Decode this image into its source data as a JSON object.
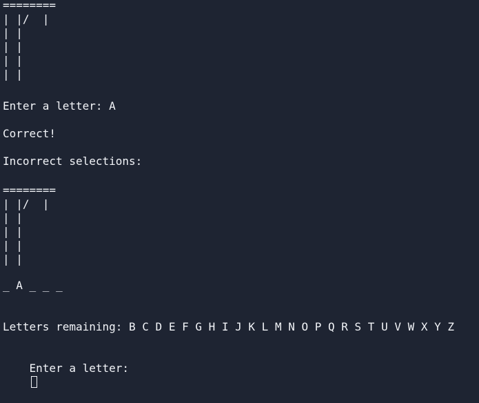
{
  "terminal": {
    "gallows_top": "========\n| |/  |\n| |\n| |\n| |\n| |",
    "prompt_1": "Enter a letter: A",
    "feedback": "Correct!",
    "incorrect_label": "Incorrect selections:",
    "gallows_bottom": "========\n| |/  |\n| |\n| |\n| |\n| |",
    "word_state": "_ A _ _ _",
    "letters_remaining": "Letters remaining: B C D E F G H I J K L M N O P Q R S T U V W X Y Z",
    "prompt_2": "Enter a letter:"
  }
}
